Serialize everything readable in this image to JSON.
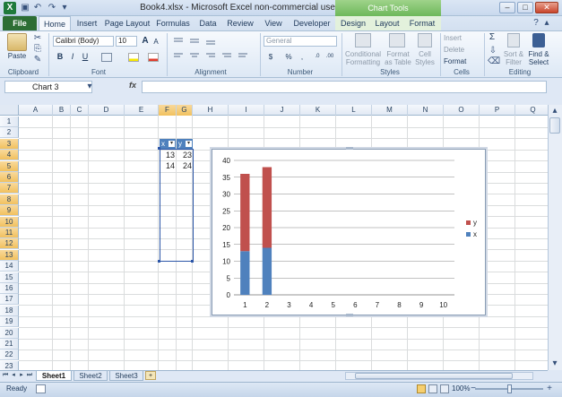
{
  "window": {
    "title": "Book4.xlsx - Microsoft Excel non-commercial use",
    "contextual_tab_group": "Chart Tools",
    "app_icon": "X",
    "controls": {
      "minimize": "–",
      "maximize": "□",
      "close": "✕"
    }
  },
  "ribbon_tabs": [
    "File",
    "Home",
    "Insert",
    "Page Layout",
    "Formulas",
    "Data",
    "Review",
    "View",
    "Developer",
    "Design",
    "Layout",
    "Format"
  ],
  "ribbon": {
    "clipboard": {
      "paste": "Paste",
      "label": "Clipboard"
    },
    "font": {
      "name": "Calibri (Body)",
      "size": "10",
      "label": "Font",
      "bold": "B",
      "italic": "I",
      "underline": "U",
      "grow": "A",
      "shrink": "A"
    },
    "alignment": {
      "label": "Alignment"
    },
    "number": {
      "format": "General",
      "label": "Number",
      "currency": "$",
      "percent": "%"
    },
    "styles": {
      "conditional": "Conditional Formatting",
      "format_table": "Format as Table",
      "cell_styles": "Cell Styles",
      "label": "Styles"
    },
    "cells": {
      "insert": "Insert",
      "delete": "Delete",
      "format": "Format",
      "label": "Cells"
    },
    "editing": {
      "sum": "Σ",
      "sort": "Sort & Filter",
      "find": "Find & Select",
      "label": "Editing"
    }
  },
  "formula_bar": {
    "name_box": "Chart 3",
    "fx": "fx",
    "formula": ""
  },
  "columns": [
    "A",
    "B",
    "C",
    "D",
    "E",
    "F",
    "G",
    "H",
    "I",
    "J",
    "K",
    "L",
    "M",
    "N",
    "O",
    "P",
    "Q"
  ],
  "rows": [
    "1",
    "2",
    "3",
    "4",
    "5",
    "6",
    "7",
    "8",
    "9",
    "10",
    "11",
    "12",
    "13",
    "14",
    "15",
    "16",
    "17",
    "18",
    "19",
    "20",
    "21",
    "22",
    "23"
  ],
  "table": {
    "headers": [
      "x",
      "y"
    ],
    "rows": [
      [
        "13",
        "23"
      ],
      [
        "14",
        "24"
      ]
    ]
  },
  "chart_data": {
    "type": "bar",
    "stacked": true,
    "categories": [
      "1",
      "2",
      "3",
      "4",
      "5",
      "6",
      "7",
      "8",
      "9",
      "10"
    ],
    "series": [
      {
        "name": "x",
        "color": "#4f81bd",
        "values": [
          13,
          14,
          null,
          null,
          null,
          null,
          null,
          null,
          null,
          null
        ]
      },
      {
        "name": "y",
        "color": "#c0504d",
        "values": [
          23,
          24,
          null,
          null,
          null,
          null,
          null,
          null,
          null,
          null
        ]
      }
    ],
    "ylim": [
      0,
      40
    ],
    "yticks": [
      "0",
      "5",
      "10",
      "15",
      "20",
      "25",
      "30",
      "35",
      "40"
    ],
    "grid": true,
    "legend": "right",
    "title": "",
    "xlabel": "",
    "ylabel": ""
  },
  "sheets": [
    "Sheet1",
    "Sheet2",
    "Sheet3"
  ],
  "active_sheet": "Sheet1",
  "status": {
    "ready": "Ready",
    "zoom": "100%"
  }
}
